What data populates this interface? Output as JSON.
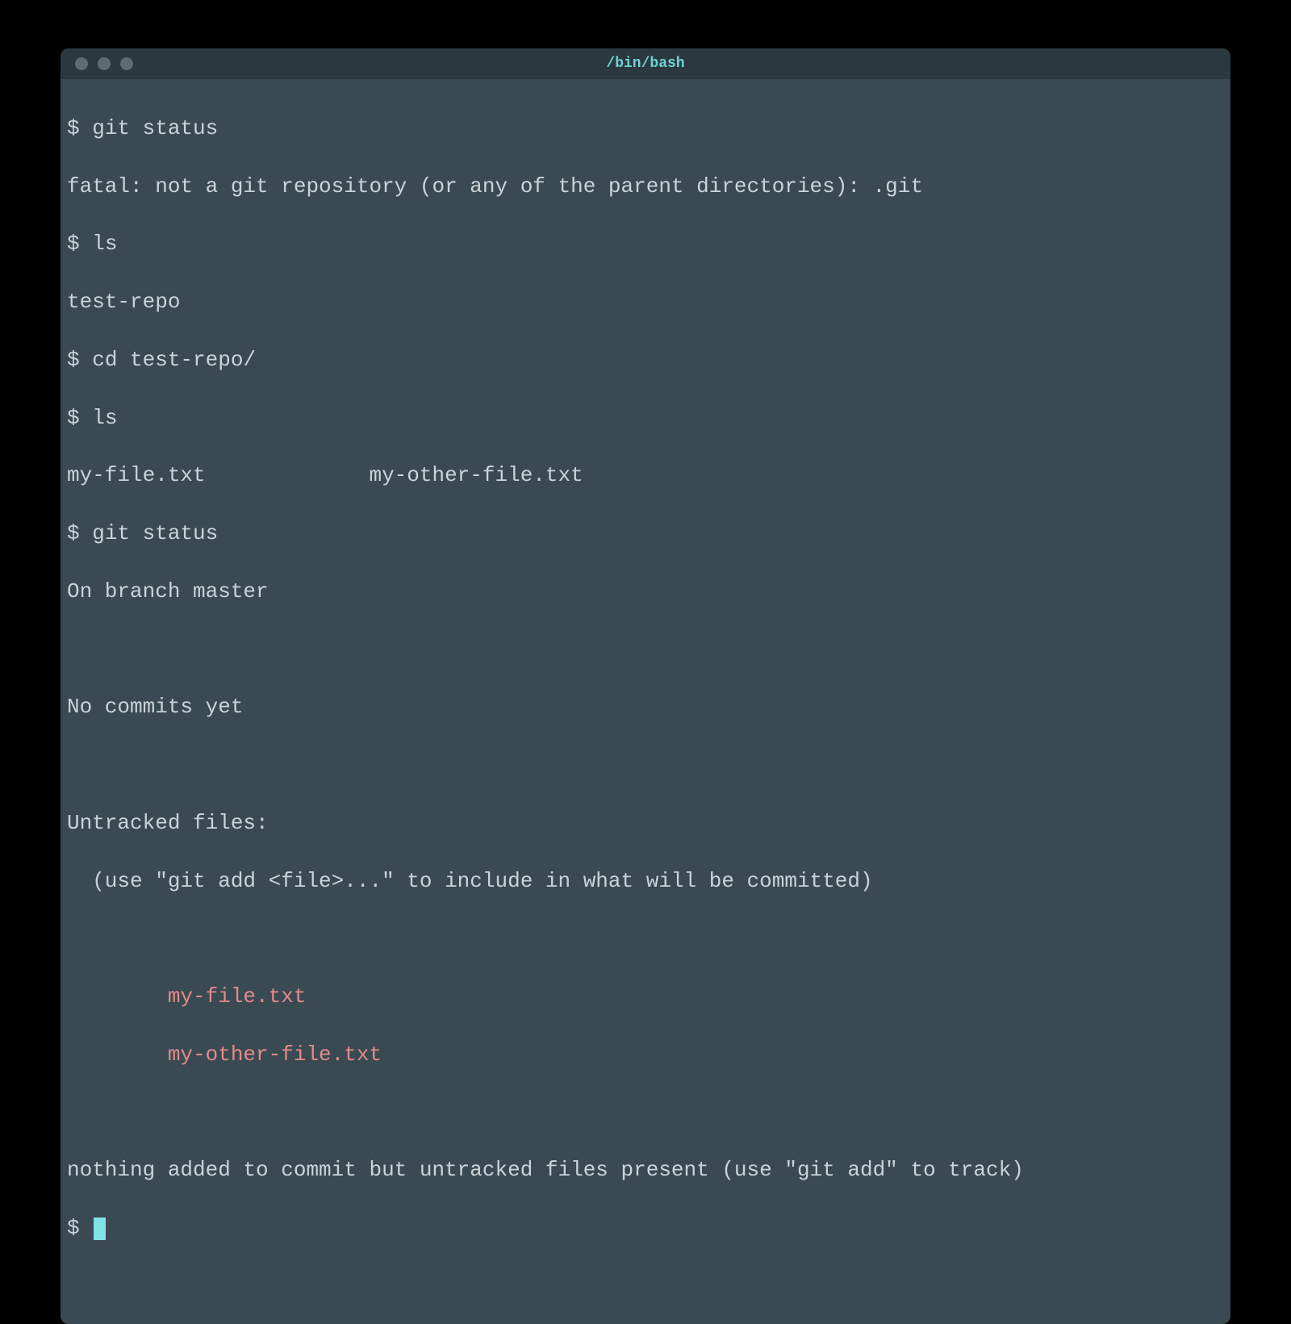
{
  "window": {
    "title": "/bin/bash"
  },
  "prompt": "$",
  "lines": {
    "cmd1": "git status",
    "out1": "fatal: not a git repository (or any of the parent directories): .git",
    "cmd2": "ls",
    "out2": "test-repo",
    "cmd3": "cd test-repo/",
    "cmd4": "ls",
    "out4": "my-file.txt             my-other-file.txt",
    "cmd5": "git status",
    "out5a": "On branch master",
    "out5b": "No commits yet",
    "out5c": "Untracked files:",
    "out5d": "  (use \"git add <file>...\" to include in what will be committed)",
    "file1": "        my-file.txt",
    "file2": "        my-other-file.txt",
    "out5e": "nothing added to commit but untracked files present (use \"git add\" to track)"
  },
  "colors": {
    "untracked_file": "#e38a8a",
    "cursor": "#7fe3e8",
    "titlebar_text": "#6fd3d8",
    "terminal_bg": "#3a4a52",
    "titlebar_bg": "#2b383f",
    "text": "#c9d4d8"
  }
}
